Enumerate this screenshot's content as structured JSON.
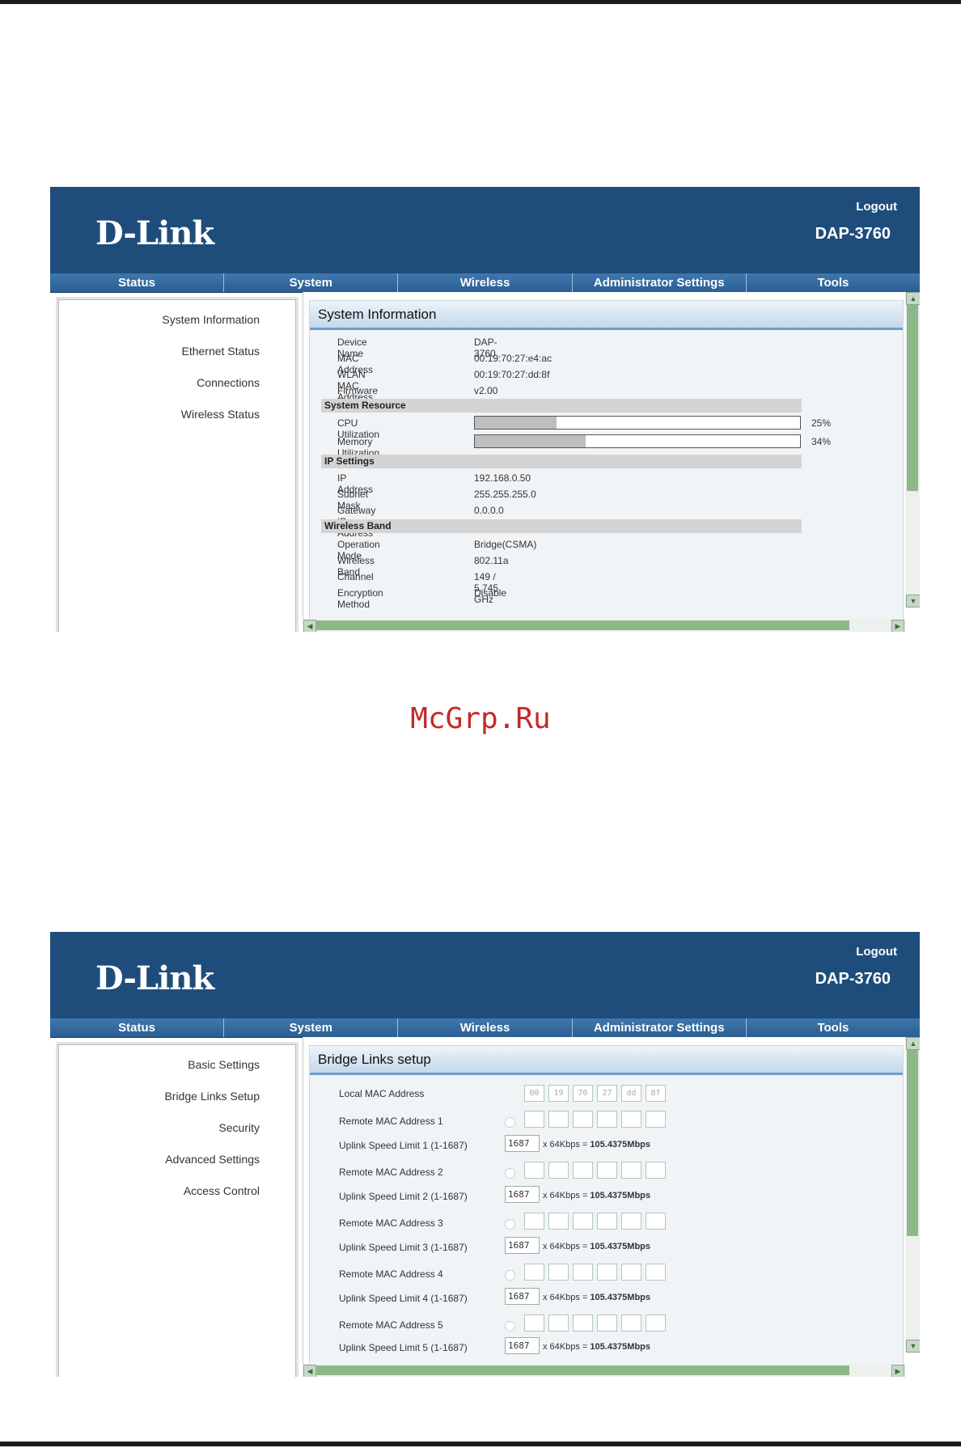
{
  "common": {
    "logo": "D-Link",
    "logout": "Logout",
    "model": "DAP-3760",
    "tabs": [
      "Status",
      "System",
      "Wireless",
      "Administrator Settings",
      "Tools"
    ]
  },
  "screen1": {
    "sidebar": [
      "System Information",
      "Ethernet Status",
      "Connections",
      "Wireless Status"
    ],
    "title": "System Information",
    "device_name_label": "Device Name",
    "device_name": "DAP-3760",
    "mac_label": "MAC Address",
    "mac": "00:19:70:27:e4:ac",
    "wlan_mac_label": "WLAN MAC Address",
    "wlan_mac": "00:19:70:27:dd:8f",
    "fw_label": "Firmware Version",
    "fw": "v2.00",
    "sec_resource": "System Resource",
    "cpu_label": "CPU Utilization",
    "cpu_pct": 25,
    "cpu_text": "25%",
    "mem_label": "Memory Utilization",
    "mem_pct": 34,
    "mem_text": "34%",
    "sec_ip": "IP Settings",
    "ip_label": "IP Address",
    "ip": "192.168.0.50",
    "mask_label": "Subnet Mask",
    "mask": "255.255.255.0",
    "gw_label": "Gateway IP Address",
    "gw": "0.0.0.0",
    "sec_wband": "Wireless Band",
    "opmode_label": "Operation Mode",
    "opmode": "Bridge(CSMA)",
    "band_label": "Wireless Band",
    "band": "802.11a",
    "channel_label": "Channel",
    "channel": "149 / 5.745 GHz",
    "enc_label": "Encryption Method",
    "enc": "Disable"
  },
  "watermark": "McGrp.Ru",
  "screen2": {
    "sidebar": [
      "Basic Settings",
      "Bridge Links Setup",
      "Security",
      "Advanced Settings",
      "Access Control"
    ],
    "title": "Bridge Links setup",
    "local_mac_label": "Local MAC Address",
    "local_mac": [
      "00",
      "19",
      "70",
      "27",
      "dd",
      "8f"
    ],
    "remote1": "Remote MAC Address 1",
    "uplink1": "Uplink Speed Limit 1 (1-1687)",
    "remote2": "Remote MAC Address 2",
    "uplink2": "Uplink Speed Limit 2 (1-1687)",
    "remote3": "Remote MAC Address 3",
    "uplink3": "Uplink Speed Limit 3 (1-1687)",
    "remote4": "Remote MAC Address 4",
    "uplink4": "Uplink Speed Limit 4 (1-1687)",
    "remote5": "Remote MAC Address 5",
    "uplink5": "Uplink Speed Limit 5 (1-1687)",
    "speed_value": "1687",
    "speed_mult": "x 64Kbps =",
    "speed_result": "105.4375Mbps"
  }
}
